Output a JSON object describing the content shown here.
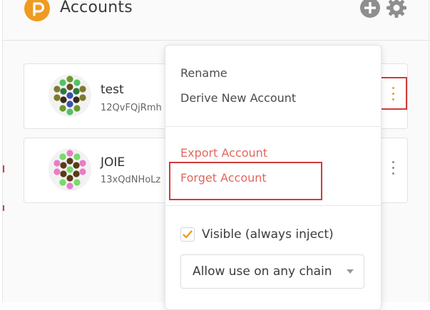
{
  "header": {
    "title": "Accounts",
    "logo_icon": "polkadot-js-logo",
    "add_icon": "plus-circle-icon",
    "settings_icon": "gear-icon"
  },
  "accounts": [
    {
      "name": "test",
      "address": "12QvFQjRmh",
      "menu_icon": "vertical-dots-icon",
      "menu_color": "#f09a20"
    },
    {
      "name": "JOIE",
      "address": "13xQdNHoLz",
      "menu_icon": "vertical-dots-icon",
      "menu_color": "#8a8a8a"
    }
  ],
  "menu": {
    "rename": "Rename",
    "derive": "Derive New Account",
    "export": "Export Account",
    "forget": "Forget Account",
    "visible_label": "Visible (always inject)",
    "visible_checked": true,
    "chain_select": "Allow use on any chain"
  },
  "colors": {
    "accent": "#f09a20",
    "danger_text": "#e0675f",
    "highlight_box": "#cf3c3c"
  }
}
